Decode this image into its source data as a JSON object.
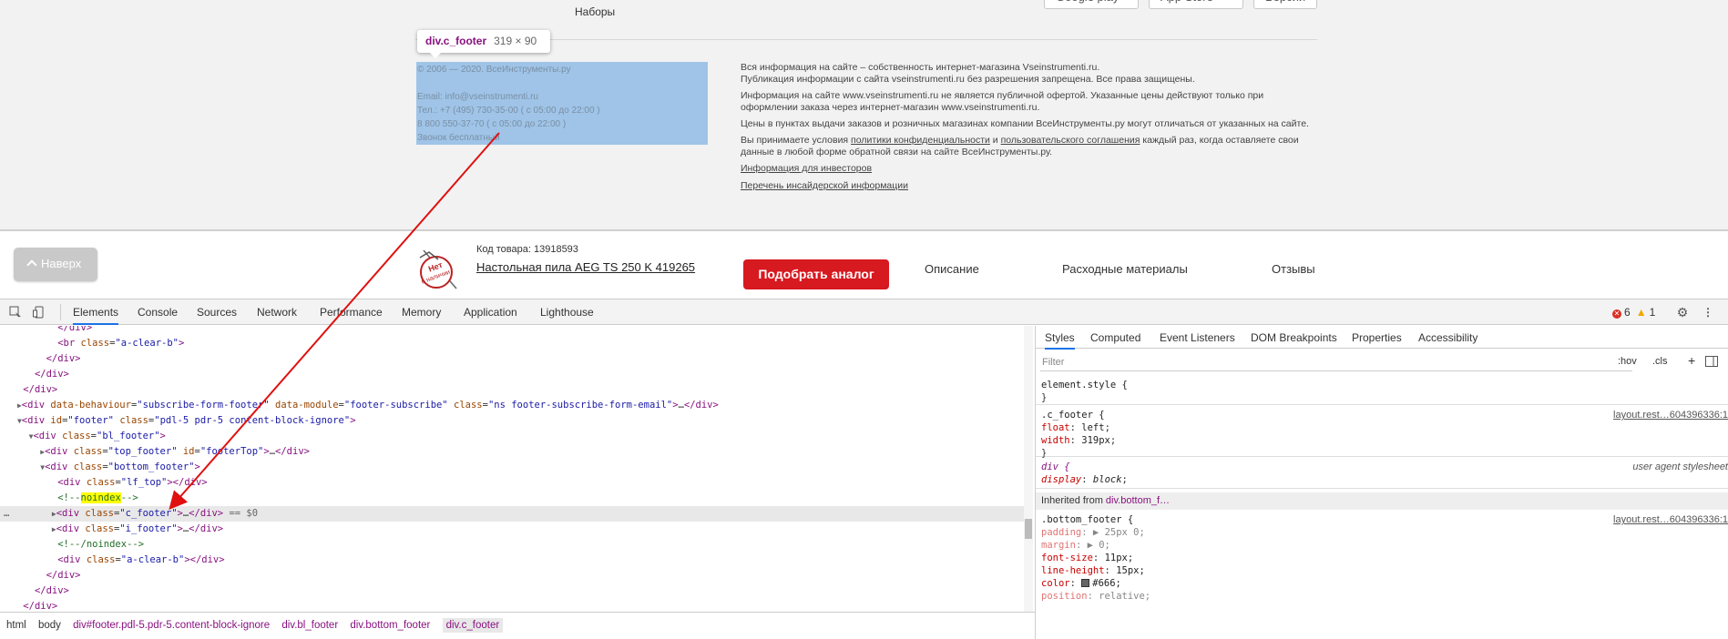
{
  "site": {
    "nabory_label": "Наборы",
    "store_buttons": [
      "Google play",
      "App Store",
      "Версии"
    ],
    "tooltip": {
      "name": "div.c_footer",
      "size": "319 × 90"
    },
    "contacts": [
      "© 2006 — 2020. ВсеИнструменты.ру",
      "",
      "Email: info@vseinstrumenti.ru",
      "Тел.: +7 (495) 730-35-00 ( с 05:00 до 22:00 )",
      "8 800 550-37-70 ( с 05:00 до 22:00 )",
      "Звонок бесплатный"
    ],
    "info": {
      "p1_line1": "Вся информация на сайте – собственность интернет-магазина Vseinstrumenti.ru.",
      "p1_line2": "Публикация информации с сайта vseinstrumenti.ru без разрешения запрещена. Все права защищены.",
      "p2": "Информация на сайте www.vseinstrumenti.ru не является публичной офертой. Указанные цены действуют только при оформлении заказа через интернет-магазин www.vseinstrumenti.ru.",
      "p3": "Цены в пунктах выдачи заказов и розничных магазинах компании ВсеИнструменты.ру могут отличаться от указанных на сайте.",
      "p4_a": "Вы принимаете условия ",
      "p4_link1": "политики конфиденциальности",
      "p4_b": " и ",
      "p4_link2": "пользовательского соглашения",
      "p4_c": " каждый раз, когда оставляете свои данные в любой форме обратной связи на сайте ВсеИнструменты.ру.",
      "investors_link": "Информация для инвесторов",
      "insider_link": "Перечень инсайдерской информации"
    }
  },
  "product_bar": {
    "up_label": "Наверх",
    "code": "Код товара: 13918593",
    "name": "Настольная пила AEG TS 250 K 419265",
    "analog_button": "Подобрать аналог",
    "nav": [
      "Описание",
      "Расходные материалы",
      "Отзывы"
    ]
  },
  "devtools": {
    "tabs": [
      "Elements",
      "Console",
      "Sources",
      "Network",
      "Performance",
      "Memory",
      "Application",
      "Lighthouse"
    ],
    "errors": "6",
    "warnings": "1",
    "breadcrumbs": [
      "html",
      "body",
      "div#footer.pdl-5.pdr-5.content-block-ignore",
      "div.bl_footer",
      "div.bottom_footer",
      "div.c_footer"
    ],
    "styles_tabs": [
      "Styles",
      "Computed",
      "Event Listeners",
      "DOM Breakpoints",
      "Properties",
      "Accessibility"
    ],
    "filter_placeholder": "Filter",
    "hov": ":hov",
    "cls": ".cls",
    "element_style": "element.style {",
    "rule_c_footer": {
      "selector": ".c_footer {",
      "source": "layout.rest…604396336:1",
      "props": [
        [
          "float",
          "left"
        ],
        [
          "width",
          "319px"
        ]
      ]
    },
    "rule_div": {
      "selector": "div {",
      "source": "user agent stylesheet",
      "props": [
        [
          "display",
          "block"
        ]
      ]
    },
    "inherited_label": "Inherited from ",
    "inherited_from": "div.bottom_f…",
    "rule_bottom_footer": {
      "selector": ".bottom_footer {",
      "source": "layout.rest…604396336:1",
      "props": [
        [
          "padding",
          "▶ 25px 0;"
        ],
        [
          "margin",
          "▶ 0;"
        ],
        [
          "font-size",
          "11px;"
        ],
        [
          "line-height",
          "15px;"
        ],
        [
          "color",
          "#666;"
        ],
        [
          "position",
          "relative;"
        ]
      ]
    },
    "selected_suffix": "== $0"
  }
}
